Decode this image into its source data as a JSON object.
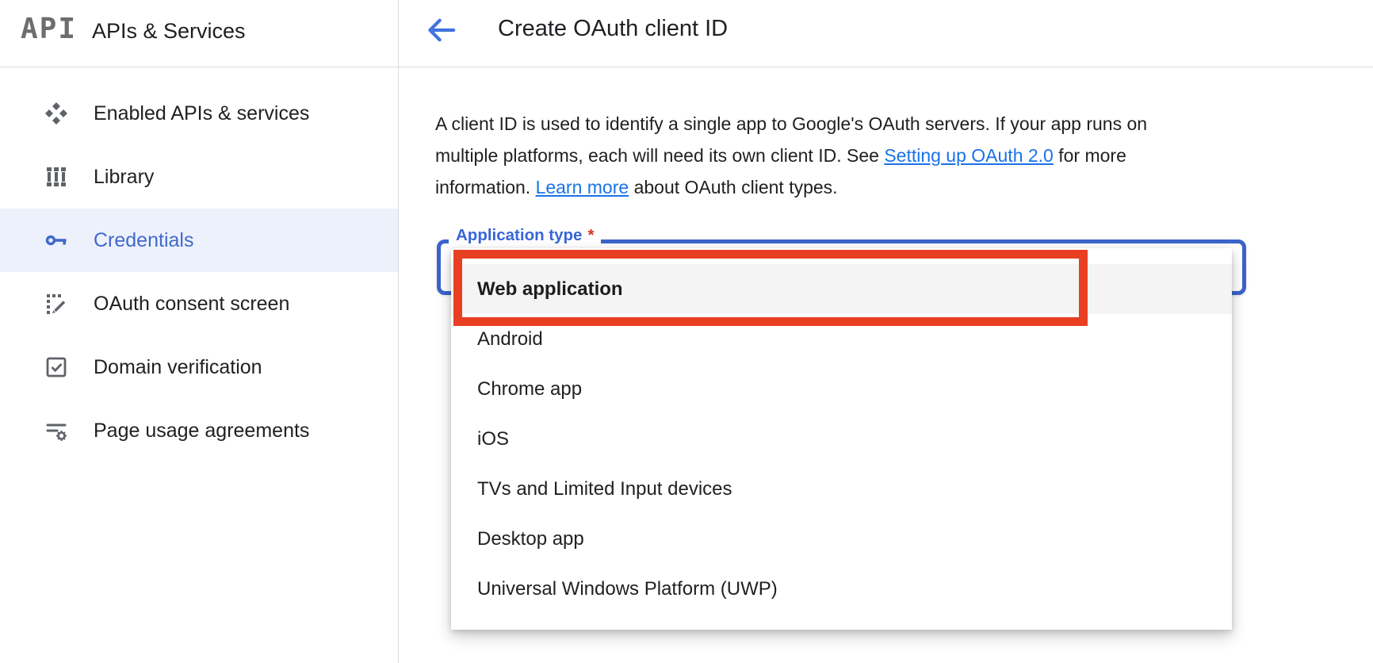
{
  "app": {
    "product_logo": "API",
    "product_name": "APIs & Services"
  },
  "sidebar": {
    "items": [
      {
        "label": "Enabled APIs & services",
        "icon": "apis-icon",
        "selected": false
      },
      {
        "label": "Library",
        "icon": "library-icon",
        "selected": false
      },
      {
        "label": "Credentials",
        "icon": "key-icon",
        "selected": true
      },
      {
        "label": "OAuth consent screen",
        "icon": "oauth-consent-icon",
        "selected": false
      },
      {
        "label": "Domain verification",
        "icon": "domain-verification-icon",
        "selected": false
      },
      {
        "label": "Page usage agreements",
        "icon": "page-usage-icon",
        "selected": false
      }
    ]
  },
  "header": {
    "title": "Create OAuth client ID",
    "back_icon": "back-arrow-icon"
  },
  "intro": {
    "line1": "A client ID is used to identify a single app to Google's OAuth servers. If your app runs on",
    "line2_pre": "multiple platforms, each will need its own client ID. See ",
    "link1": "Setting up OAuth 2.0",
    "line2_post": " for more",
    "line3_pre": "information. ",
    "link2": "Learn more",
    "line3_post": " about OAuth client types."
  },
  "form": {
    "field_label": "Application type",
    "required_marker": "*",
    "options": [
      "Web application",
      "Android",
      "Chrome app",
      "iOS",
      "TVs and Limited Input devices",
      "Desktop app",
      "Universal Windows Platform (UWP)"
    ],
    "highlighted_option": "Web application"
  },
  "colors": {
    "annotation_red": "#e83f23",
    "focus_border_blue": "#3c63c9",
    "field_label_blue": "#3866d6",
    "link_blue": "#1a73e8",
    "selected_nav_text": "#4169cd",
    "selected_nav_bg": "#edf1fb",
    "icon_gray": "#5f6368",
    "text_dark": "#202124",
    "divider_gray": "#dadce0",
    "option_selected_bg": "#f4f4f4",
    "required_red": "#d93025"
  }
}
